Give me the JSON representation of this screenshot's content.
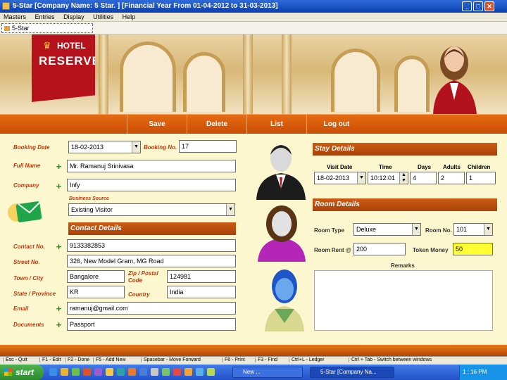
{
  "window": {
    "title": "5-Star [Company Name: 5 Star. ] [Financial Year From 01-04-2012 to 31-03-2013]",
    "min": "_",
    "max": "□",
    "close": "✕"
  },
  "menu": [
    "Masters",
    "Entries",
    "Display",
    "Utilities",
    "Help"
  ],
  "tab": {
    "label": "5-Star"
  },
  "logo": {
    "line1": "HOTEL",
    "line2": "RESERVE"
  },
  "nav": {
    "save": "Save",
    "delete": "Delete",
    "list": "List",
    "logout": "Log out"
  },
  "booking": {
    "date_label": "Booking Date",
    "date_value": "18-02-2013",
    "no_label": "Booking No.",
    "no_value": "17",
    "fullname_label": "Full Name",
    "fullname_value": "Mr. Ramanuj Srinivasa",
    "company_label": "Company",
    "company_value": "Infy",
    "source_label": "Business Source",
    "source_value": "Existing Visitor"
  },
  "contact": {
    "header": "Contact Details",
    "contact_label": "Contact No.",
    "contact_value": "9133382853",
    "street_label": "Street No.",
    "street_value": "326, New Model Gram, MG Road",
    "town_label": "Town / City",
    "town_value": "Bangalore",
    "zip_label": "Zip / Postal Code",
    "zip_value": "124981",
    "state_label": "State / Province",
    "state_value": "KR",
    "country_label": "Country",
    "country_value": "India",
    "email_label": "Email",
    "email_value": "ramanuj@gmail.com",
    "documents_label": "Documents",
    "documents_value": "Passport"
  },
  "stay": {
    "header": "Stay Details",
    "col_visit": "Visit Date",
    "col_time": "Time",
    "col_days": "Days",
    "col_adults": "Adults",
    "col_children": "Children",
    "visit_value": "18-02-2013",
    "time_value": "10:12:01",
    "days_value": "4",
    "adults_value": "2",
    "children_value": "1"
  },
  "room": {
    "header": "Room Details",
    "type_label": "Room Type",
    "type_value": "Deluxe",
    "no_label": "Room No.",
    "no_value": "101",
    "rent_label": "Room Rent @",
    "rent_value": "200",
    "token_label": "Token Money",
    "token_value": "50",
    "remarks_label": "Remarks"
  },
  "shortcuts": [
    "Esc - Quit",
    "F1 - Edit",
    "F2 - Done",
    "F5 - Add New",
    "Spacebar - Move Forward",
    "F6 - Print",
    "F3 - Find",
    "Ctrl+L - Ledger",
    "Ctrl + Tab - Switch between windows"
  ],
  "taskbar": {
    "start": "start",
    "task1": "New ...",
    "task2": "5-Star [Company Na...",
    "clock": "1 : 16 PM"
  },
  "colors": {
    "accent": "#d35a0f",
    "label": "#c2360a",
    "formbg": "#fdf7cf",
    "token_bg": "#ffff33"
  }
}
